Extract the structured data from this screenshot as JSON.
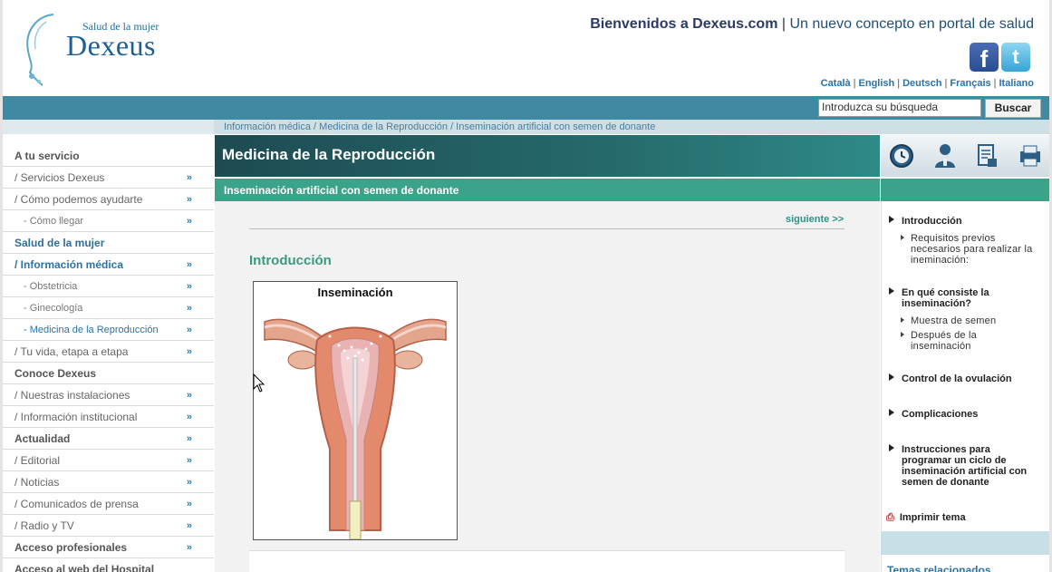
{
  "header": {
    "logo_subtitle": "Salud de la mujer",
    "logo_name": "Dexeus",
    "welcome_strong": "Bienvenidos a Dexeus.com",
    "welcome_sep": " | ",
    "welcome_rest": "Un nuevo concepto en portal de salud",
    "facebook": "f",
    "twitter": "t",
    "languages": [
      "Català",
      "English",
      "Deutsch",
      "Français",
      "Italiano"
    ]
  },
  "search": {
    "placeholder": "Introduzca su búsqueda",
    "button": "Buscar"
  },
  "breadcrumb": "Información médica / Medicina de la Reproducción / Inseminación artificial con semen de donante",
  "sidebar": {
    "items": [
      {
        "label": "A tu servicio",
        "arrow": ""
      },
      {
        "label": "/ Servicios Dexeus",
        "arrow": "»"
      },
      {
        "label": "/ Cómo podemos ayudarte",
        "arrow": "»"
      },
      {
        "label": "- Cómo llegar",
        "arrow": "»"
      },
      {
        "label": "Salud de la mujer",
        "arrow": ""
      },
      {
        "label": "/ Información médica",
        "arrow": "»"
      },
      {
        "label": "- Obstetricia",
        "arrow": "»"
      },
      {
        "label": "- Ginecología",
        "arrow": "»"
      },
      {
        "label": "- Medicina de la Reproducción",
        "arrow": "»"
      },
      {
        "label": "/ Tu vida, etapa a etapa",
        "arrow": "»"
      },
      {
        "label": "Conoce Dexeus",
        "arrow": ""
      },
      {
        "label": "/ Nuestras instalaciones",
        "arrow": "»"
      },
      {
        "label": "/ Información institucional",
        "arrow": "»"
      },
      {
        "label": "Actualidad",
        "arrow": "»"
      },
      {
        "label": "/ Editorial",
        "arrow": "»"
      },
      {
        "label": "/ Noticias",
        "arrow": "»"
      },
      {
        "label": "/ Comunicados de prensa",
        "arrow": "»"
      },
      {
        "label": "/ Radio y TV",
        "arrow": "»"
      },
      {
        "label": "Acceso profesionales",
        "arrow": "»"
      },
      {
        "label": "Acceso al web del Hospital",
        "arrow": ""
      }
    ]
  },
  "main": {
    "section_title": "Medicina de la Reproducción",
    "topic_title": "Inseminación artificial con semen de donante",
    "next_link": "siguiente >>",
    "heading": "Introducción",
    "figure_caption": "Inseminación"
  },
  "right": {
    "toc": [
      {
        "label": "Introducción",
        "children": [
          "Requisitos previos necesarios para realizar la ineminación:"
        ]
      },
      {
        "label": "En qué consiste la inseminación?",
        "children": [
          "Muestra de semen",
          "Después de la inseminación"
        ]
      },
      {
        "label": "Control de la ovulación",
        "children": []
      },
      {
        "label": "Complicaciones",
        "children": []
      },
      {
        "label": "Instrucciones para programar un ciclo de inseminación artificial con semen de donante",
        "children": []
      }
    ],
    "print_label": "Imprimir tema",
    "related_label": "Temas relacionados"
  },
  "colors": {
    "topbar": "#3f89a3",
    "teal": "#3aa389",
    "link_blue": "#2a74a6"
  }
}
